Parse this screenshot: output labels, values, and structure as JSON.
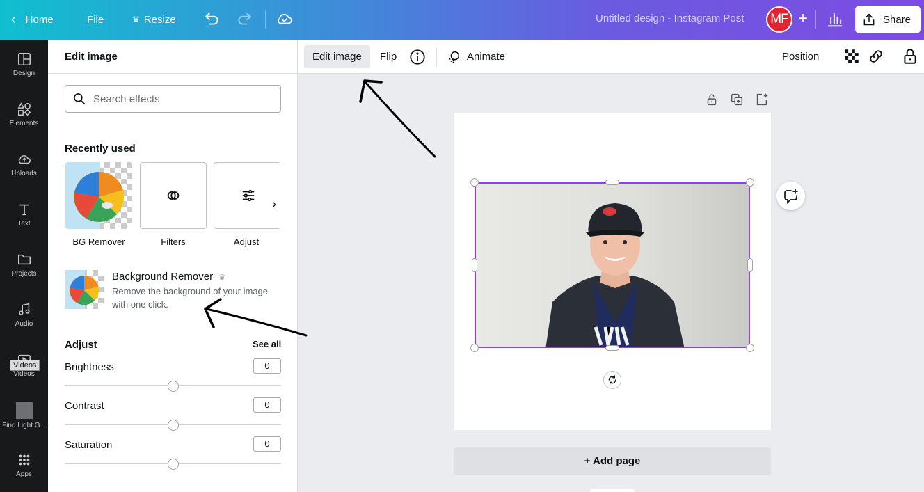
{
  "topbar": {
    "home_label": "Home",
    "file_label": "File",
    "resize_label": "Resize",
    "design_title": "Untitled design - Instagram Post",
    "avatar_initials": "MF",
    "share_label": "Share"
  },
  "rail": {
    "items": [
      {
        "label": "Design",
        "icon": "design-icon"
      },
      {
        "label": "Elements",
        "icon": "elements-icon"
      },
      {
        "label": "Uploads",
        "icon": "upload-icon"
      },
      {
        "label": "Text",
        "icon": "text-icon"
      },
      {
        "label": "Projects",
        "icon": "folder-icon"
      },
      {
        "label": "Audio",
        "icon": "music-icon"
      },
      {
        "label": "Videos",
        "icon": "video-icon"
      },
      {
        "label": "Find Light G...",
        "icon": "app-thumbnail"
      },
      {
        "label": "Apps",
        "icon": "apps-grid-icon"
      }
    ],
    "tooltip": "Videos"
  },
  "panel": {
    "title": "Edit image",
    "search_placeholder": "Search effects",
    "recently_used_title": "Recently used",
    "effects": [
      {
        "label": "BG Remover"
      },
      {
        "label": "Filters"
      },
      {
        "label": "Adjust"
      }
    ],
    "bg_remover": {
      "title": "Background Remover",
      "description": "Remove the background of your image with one click."
    },
    "adjust_title": "Adjust",
    "see_all_label": "See all",
    "sliders": [
      {
        "label": "Brightness",
        "value": "0",
        "level": 0.5
      },
      {
        "label": "Contrast",
        "value": "0",
        "level": 0.5
      },
      {
        "label": "Saturation",
        "value": "0",
        "level": 0.5
      }
    ]
  },
  "context_toolbar": {
    "edit_image_label": "Edit image",
    "flip_label": "Flip",
    "animate_label": "Animate",
    "position_label": "Position"
  },
  "canvas": {
    "add_page_label": "+ Add page",
    "selection_color": "#8b3dff"
  },
  "colors": {
    "topbar_start": "#10bfcf",
    "topbar_end": "#7d4be3",
    "rail_bg": "#18191b",
    "avatar_bg": "#e02434",
    "selection": "#8b3dff"
  }
}
